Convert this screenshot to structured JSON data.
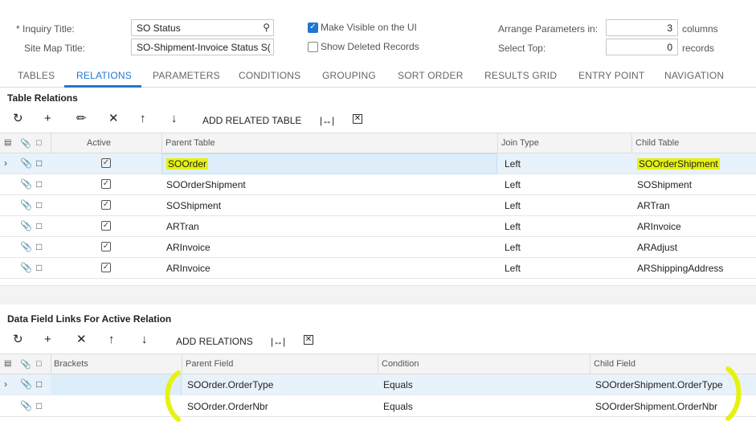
{
  "header": {
    "inquiry_title_label": "Inquiry Title:",
    "inquiry_title_required": "*",
    "inquiry_title_value": "SO Status",
    "site_map_title_label": "Site Map Title:",
    "site_map_title_value": "SO-Shipment-Invoice Status S(",
    "make_visible_label": "Make Visible on the UI",
    "make_visible_checked": true,
    "show_deleted_label": "Show Deleted Records",
    "show_deleted_checked": false,
    "arrange_label": "Arrange Parameters in:",
    "arrange_value": "3",
    "arrange_unit": "columns",
    "select_top_label": "Select Top:",
    "select_top_value": "0",
    "select_top_unit": "records"
  },
  "tabs": [
    "TABLES",
    "RELATIONS",
    "PARAMETERS",
    "CONDITIONS",
    "GROUPING",
    "SORT ORDER",
    "RESULTS GRID",
    "ENTRY POINT",
    "NAVIGATION"
  ],
  "active_tab": "RELATIONS",
  "relations": {
    "title": "Table Relations",
    "toolbar": {
      "add_related_table": "ADD RELATED TABLE"
    },
    "columns": {
      "active": "Active",
      "parent": "Parent Table",
      "join": "Join Type",
      "child": "Child Table"
    },
    "rows": [
      {
        "active": true,
        "parent": "SOOrder",
        "join": "Left",
        "child": "SOOrderShipment",
        "selected": true
      },
      {
        "active": true,
        "parent": "SOOrderShipment",
        "join": "Left",
        "child": "SOShipment"
      },
      {
        "active": true,
        "parent": "SOShipment",
        "join": "Left",
        "child": "ARTran"
      },
      {
        "active": true,
        "parent": "ARTran",
        "join": "Left",
        "child": "ARInvoice"
      },
      {
        "active": true,
        "parent": "ARInvoice",
        "join": "Left",
        "child": "ARAdjust"
      },
      {
        "active": true,
        "parent": "ARInvoice",
        "join": "Left",
        "child": "ARShippingAddress"
      }
    ]
  },
  "links": {
    "title": "Data Field Links For Active Relation",
    "toolbar": {
      "add_relations": "ADD RELATIONS"
    },
    "columns": {
      "brackets": "Brackets",
      "parent": "Parent Field",
      "condition": "Condition",
      "child": "Child Field"
    },
    "rows": [
      {
        "parent": "SOOrder.OrderType",
        "condition": "Equals",
        "child": "SOOrderShipment.OrderType",
        "selected": true
      },
      {
        "parent": "SOOrder.OrderNbr",
        "condition": "Equals",
        "child": "SOOrderShipment.OrderNbr"
      }
    ]
  },
  "colors": {
    "accent": "#1f77d0",
    "highlight": "#e6f20f",
    "selected_row": "#e8f2fb"
  }
}
